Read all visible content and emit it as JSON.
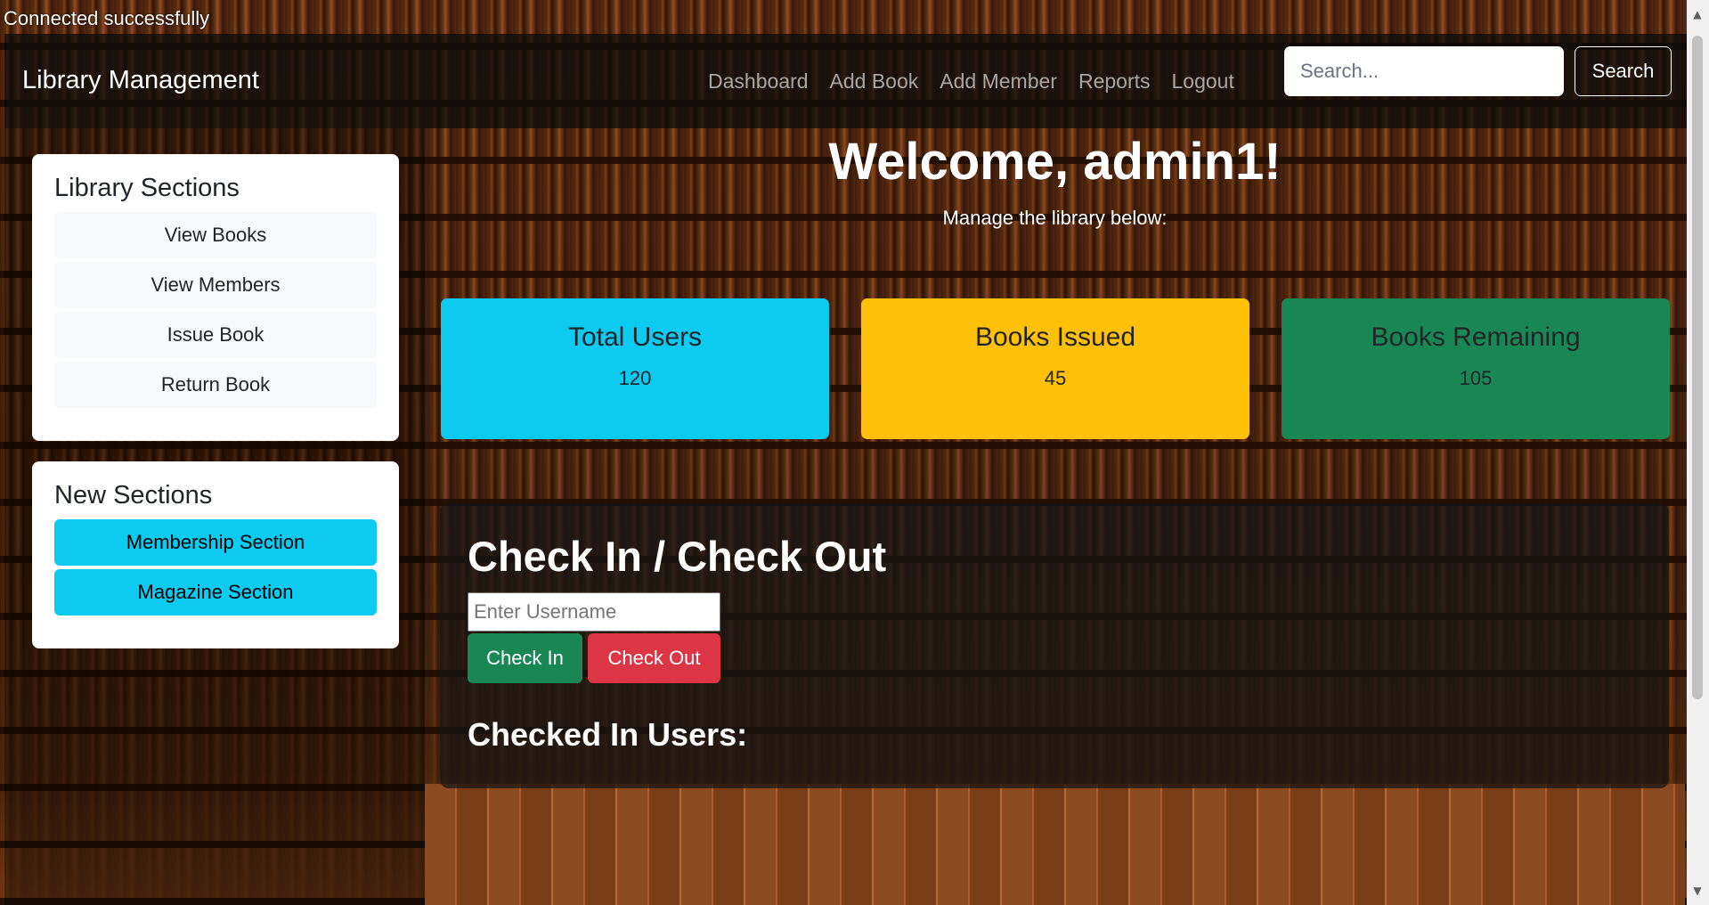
{
  "status_text": "Connected successfully",
  "navbar": {
    "brand": "Library Management",
    "links": [
      "Dashboard",
      "Add Book",
      "Add Member",
      "Reports",
      "Logout"
    ],
    "search_placeholder": "Search...",
    "search_button": "Search"
  },
  "sidebar": {
    "library_sections": {
      "title": "Library Sections",
      "items": [
        "View Books",
        "View Members",
        "Issue Book",
        "Return Book"
      ]
    },
    "new_sections": {
      "title": "New Sections",
      "items": [
        "Membership Section",
        "Magazine Section"
      ]
    }
  },
  "main": {
    "welcome": "Welcome, admin1!",
    "subtitle": "Manage the library below:",
    "stats": [
      {
        "title": "Total Users",
        "value": "120",
        "color": "#0dcaf0"
      },
      {
        "title": "Books Issued",
        "value": "45",
        "color": "#ffc107"
      },
      {
        "title": "Books Remaining",
        "value": "105",
        "color": "#198754"
      }
    ],
    "check": {
      "title": "Check In / Check Out",
      "username_placeholder": "Enter Username",
      "checkin_button": "Check In",
      "checkout_button": "Check Out",
      "checked_in_title": "Checked In Users:"
    }
  },
  "colors": {
    "info": "#0dcaf0",
    "warning": "#ffc107",
    "success": "#198754",
    "danger": "#dc3545"
  }
}
